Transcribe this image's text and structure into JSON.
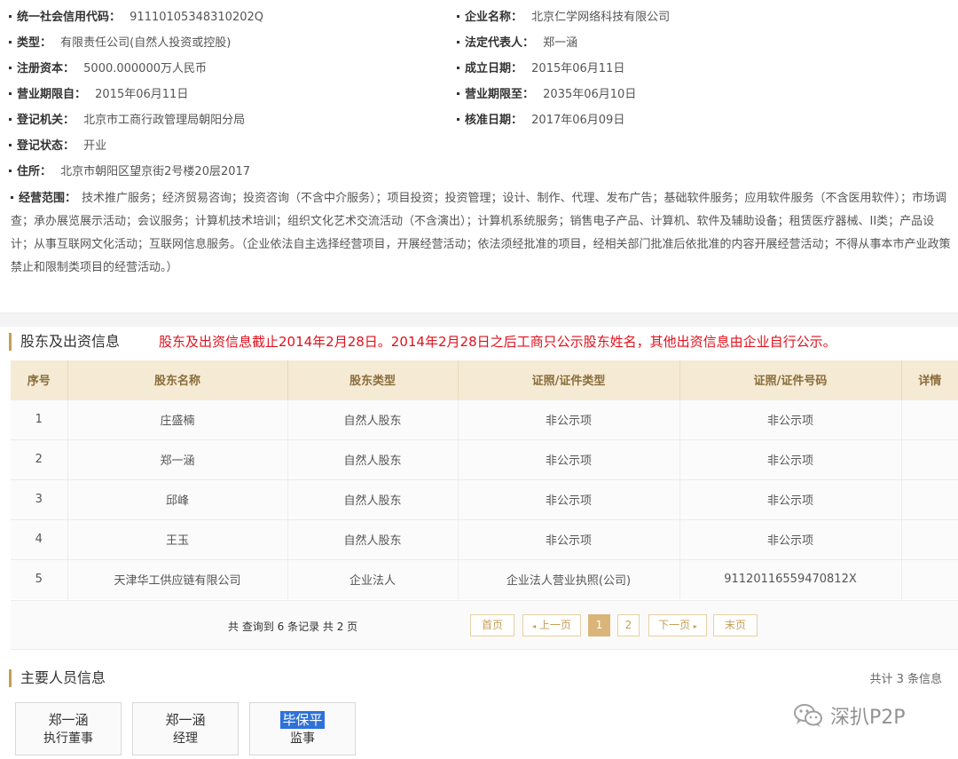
{
  "info": {
    "credit_code": {
      "label": "统一社会信用代码：",
      "value": "91110105348310202Q"
    },
    "company_name": {
      "label": "企业名称：",
      "value": "北京仁学网络科技有限公司"
    },
    "type": {
      "label": "类型：",
      "value": "有限责任公司(自然人投资或控股)"
    },
    "legal_rep": {
      "label": "法定代表人：",
      "value": "郑一涵"
    },
    "capital": {
      "label": "注册资本：",
      "value": "5000.000000万人民币"
    },
    "established": {
      "label": "成立日期：",
      "value": "2015年06月11日"
    },
    "term_from": {
      "label": "营业期限自：",
      "value": "2015年06月11日"
    },
    "term_to": {
      "label": "营业期限至：",
      "value": "2035年06月10日"
    },
    "authority": {
      "label": "登记机关：",
      "value": "北京市工商行政管理局朝阳分局"
    },
    "approval_date": {
      "label": "核准日期：",
      "value": "2017年06月09日"
    },
    "status": {
      "label": "登记状态：",
      "value": "开业"
    },
    "address": {
      "label": "住所：",
      "value": "北京市朝阳区望京街2号楼20层2017"
    },
    "scope": {
      "label": "经营范围：",
      "value": "技术推广服务；经济贸易咨询；投资咨询（不含中介服务）；项目投资；投资管理；设计、制作、代理、发布广告；基础软件服务；应用软件服务（不含医用软件）；市场调查；承办展览展示活动；会议服务；计算机技术培训；组织文化艺术交流活动（不含演出）；计算机系统服务；销售电子产品、计算机、软件及辅助设备；租赁医疗器械、II类；产品设计；从事互联网文化活动；互联网信息服务。（企业依法自主选择经营项目，开展经营活动；依法须经批准的项目，经相关部门批准后依批准的内容开展经营活动；不得从事本市产业政策禁止和限制类项目的经营活动。）"
    }
  },
  "shareholders": {
    "title": "股东及出资信息",
    "notice": "股东及出资信息截止2014年2月28日。2014年2月28日之后工商只公示股东姓名，其他出资信息由企业自行公示。",
    "columns": [
      "序号",
      "股东名称",
      "股东类型",
      "证照/证件类型",
      "证照/证件号码",
      "详情"
    ],
    "rows": [
      [
        "1",
        "庄盛楠",
        "自然人股东",
        "非公示项",
        "非公示项",
        ""
      ],
      [
        "2",
        "郑一涵",
        "自然人股东",
        "非公示项",
        "非公示项",
        ""
      ],
      [
        "3",
        "邱峰",
        "自然人股东",
        "非公示项",
        "非公示项",
        ""
      ],
      [
        "4",
        "王玉",
        "自然人股东",
        "非公示项",
        "非公示项",
        ""
      ],
      [
        "5",
        "天津华工供应链有限公司",
        "企业法人",
        "企业法人营业执照(公司)",
        "91120116559470812X",
        ""
      ]
    ],
    "summary": "共 查询到 6 条记录 共 2 页",
    "pager": {
      "first": "首页",
      "prev": "上一页",
      "page1": "1",
      "page2": "2",
      "next": "下一页",
      "last": "末页"
    }
  },
  "personnel": {
    "title": "主要人员信息",
    "count": "共计 3 条信息",
    "people": [
      {
        "name": "郑一涵",
        "role": "执行董事"
      },
      {
        "name": "郑一涵",
        "role": "经理"
      },
      {
        "name": "毕保平",
        "role": "监事"
      }
    ]
  },
  "watermark": {
    "text": "深扒P2P",
    "icon": "wechat-icon"
  },
  "colors": {
    "accent": "#c59e5a",
    "notice": "#e0121c",
    "header_bg": "#f5ead4",
    "highlight": "#2d72d9"
  }
}
